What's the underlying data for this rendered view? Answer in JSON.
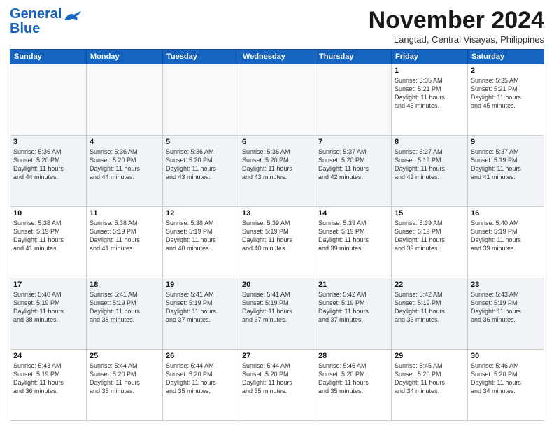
{
  "logo": {
    "line1": "General",
    "line2": "Blue"
  },
  "header": {
    "month": "November 2024",
    "location": "Langtad, Central Visayas, Philippines"
  },
  "weekdays": [
    "Sunday",
    "Monday",
    "Tuesday",
    "Wednesday",
    "Thursday",
    "Friday",
    "Saturday"
  ],
  "weeks": [
    [
      {
        "day": "",
        "info": ""
      },
      {
        "day": "",
        "info": ""
      },
      {
        "day": "",
        "info": ""
      },
      {
        "day": "",
        "info": ""
      },
      {
        "day": "",
        "info": ""
      },
      {
        "day": "1",
        "info": "Sunrise: 5:35 AM\nSunset: 5:21 PM\nDaylight: 11 hours\nand 45 minutes."
      },
      {
        "day": "2",
        "info": "Sunrise: 5:35 AM\nSunset: 5:21 PM\nDaylight: 11 hours\nand 45 minutes."
      }
    ],
    [
      {
        "day": "3",
        "info": "Sunrise: 5:36 AM\nSunset: 5:20 PM\nDaylight: 11 hours\nand 44 minutes."
      },
      {
        "day": "4",
        "info": "Sunrise: 5:36 AM\nSunset: 5:20 PM\nDaylight: 11 hours\nand 44 minutes."
      },
      {
        "day": "5",
        "info": "Sunrise: 5:36 AM\nSunset: 5:20 PM\nDaylight: 11 hours\nand 43 minutes."
      },
      {
        "day": "6",
        "info": "Sunrise: 5:36 AM\nSunset: 5:20 PM\nDaylight: 11 hours\nand 43 minutes."
      },
      {
        "day": "7",
        "info": "Sunrise: 5:37 AM\nSunset: 5:20 PM\nDaylight: 11 hours\nand 42 minutes."
      },
      {
        "day": "8",
        "info": "Sunrise: 5:37 AM\nSunset: 5:19 PM\nDaylight: 11 hours\nand 42 minutes."
      },
      {
        "day": "9",
        "info": "Sunrise: 5:37 AM\nSunset: 5:19 PM\nDaylight: 11 hours\nand 41 minutes."
      }
    ],
    [
      {
        "day": "10",
        "info": "Sunrise: 5:38 AM\nSunset: 5:19 PM\nDaylight: 11 hours\nand 41 minutes."
      },
      {
        "day": "11",
        "info": "Sunrise: 5:38 AM\nSunset: 5:19 PM\nDaylight: 11 hours\nand 41 minutes."
      },
      {
        "day": "12",
        "info": "Sunrise: 5:38 AM\nSunset: 5:19 PM\nDaylight: 11 hours\nand 40 minutes."
      },
      {
        "day": "13",
        "info": "Sunrise: 5:39 AM\nSunset: 5:19 PM\nDaylight: 11 hours\nand 40 minutes."
      },
      {
        "day": "14",
        "info": "Sunrise: 5:39 AM\nSunset: 5:19 PM\nDaylight: 11 hours\nand 39 minutes."
      },
      {
        "day": "15",
        "info": "Sunrise: 5:39 AM\nSunset: 5:19 PM\nDaylight: 11 hours\nand 39 minutes."
      },
      {
        "day": "16",
        "info": "Sunrise: 5:40 AM\nSunset: 5:19 PM\nDaylight: 11 hours\nand 39 minutes."
      }
    ],
    [
      {
        "day": "17",
        "info": "Sunrise: 5:40 AM\nSunset: 5:19 PM\nDaylight: 11 hours\nand 38 minutes."
      },
      {
        "day": "18",
        "info": "Sunrise: 5:41 AM\nSunset: 5:19 PM\nDaylight: 11 hours\nand 38 minutes."
      },
      {
        "day": "19",
        "info": "Sunrise: 5:41 AM\nSunset: 5:19 PM\nDaylight: 11 hours\nand 37 minutes."
      },
      {
        "day": "20",
        "info": "Sunrise: 5:41 AM\nSunset: 5:19 PM\nDaylight: 11 hours\nand 37 minutes."
      },
      {
        "day": "21",
        "info": "Sunrise: 5:42 AM\nSunset: 5:19 PM\nDaylight: 11 hours\nand 37 minutes."
      },
      {
        "day": "22",
        "info": "Sunrise: 5:42 AM\nSunset: 5:19 PM\nDaylight: 11 hours\nand 36 minutes."
      },
      {
        "day": "23",
        "info": "Sunrise: 5:43 AM\nSunset: 5:19 PM\nDaylight: 11 hours\nand 36 minutes."
      }
    ],
    [
      {
        "day": "24",
        "info": "Sunrise: 5:43 AM\nSunset: 5:19 PM\nDaylight: 11 hours\nand 36 minutes."
      },
      {
        "day": "25",
        "info": "Sunrise: 5:44 AM\nSunset: 5:20 PM\nDaylight: 11 hours\nand 35 minutes."
      },
      {
        "day": "26",
        "info": "Sunrise: 5:44 AM\nSunset: 5:20 PM\nDaylight: 11 hours\nand 35 minutes."
      },
      {
        "day": "27",
        "info": "Sunrise: 5:44 AM\nSunset: 5:20 PM\nDaylight: 11 hours\nand 35 minutes."
      },
      {
        "day": "28",
        "info": "Sunrise: 5:45 AM\nSunset: 5:20 PM\nDaylight: 11 hours\nand 35 minutes."
      },
      {
        "day": "29",
        "info": "Sunrise: 5:45 AM\nSunset: 5:20 PM\nDaylight: 11 hours\nand 34 minutes."
      },
      {
        "day": "30",
        "info": "Sunrise: 5:46 AM\nSunset: 5:20 PM\nDaylight: 11 hours\nand 34 minutes."
      }
    ]
  ]
}
